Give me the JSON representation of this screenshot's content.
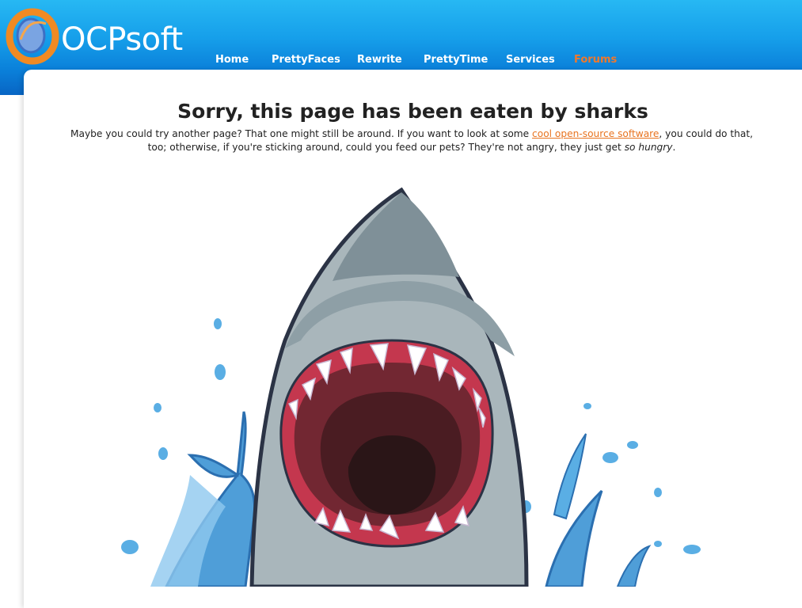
{
  "site": {
    "brand": "OCPsoft",
    "logo_icon": "ocpsoft-swirl-logo-icon"
  },
  "nav": {
    "items": [
      {
        "label": "Home"
      },
      {
        "label": "PrettyFaces"
      },
      {
        "label": "Rewrite"
      },
      {
        "label": "PrettyTime"
      },
      {
        "label": "Services"
      },
      {
        "label": "Forums",
        "active": true
      }
    ]
  },
  "page": {
    "title": "Sorry, this page has been eaten by sharks",
    "intro_before_link": "Maybe you could try another page? That one might still be around. If you want to look at some ",
    "intro_link": "cool open-source software",
    "intro_after_link": ", you could do that, too; otherwise, if you're sticking around, could you feed our pets? They're not angry, they just get ",
    "intro_emphasis": "so hungry",
    "intro_end": "."
  },
  "illustration": {
    "subject": "shark-open-mouth",
    "colors": {
      "shark_light": "#a9b6bb",
      "shark_dark": "#6e8088",
      "outline": "#2b3345",
      "gums": "#c4374e",
      "mouth": "#722732",
      "throat": "#2a1517",
      "water": "#4f9ed8"
    }
  },
  "colors": {
    "header_top": "#27b8f3",
    "header_bottom": "#0865c4",
    "nav_active": "#f0782c",
    "link": "#e8731f"
  }
}
